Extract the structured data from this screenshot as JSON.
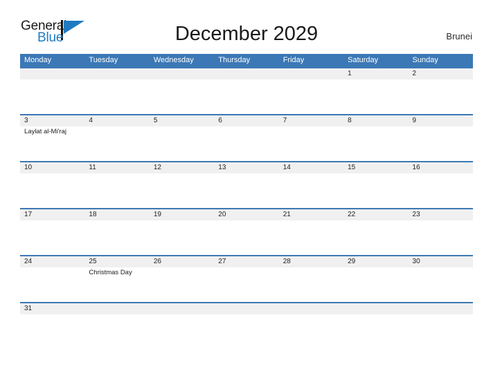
{
  "brand": {
    "word_one": "General",
    "word_two": "Blue",
    "flag_icon": "flag-triangle-icon",
    "accent_color": "#1f7ac2",
    "text_color": "#1a1a1a"
  },
  "header": {
    "title": "December 2029",
    "country": "Brunei"
  },
  "calendar": {
    "header_bg": "#3b78b5",
    "daynum_band_bg": "#f0f0f0",
    "row_border_color": "#3b78b5",
    "weekdays": [
      "Monday",
      "Tuesday",
      "Wednesday",
      "Thursday",
      "Friday",
      "Saturday",
      "Sunday"
    ],
    "weeks": [
      {
        "days": [
          {
            "num": "",
            "event": ""
          },
          {
            "num": "",
            "event": ""
          },
          {
            "num": "",
            "event": ""
          },
          {
            "num": "",
            "event": ""
          },
          {
            "num": "",
            "event": ""
          },
          {
            "num": "1",
            "event": ""
          },
          {
            "num": "2",
            "event": ""
          }
        ]
      },
      {
        "days": [
          {
            "num": "3",
            "event": "Laylat al-Mi'raj"
          },
          {
            "num": "4",
            "event": ""
          },
          {
            "num": "5",
            "event": ""
          },
          {
            "num": "6",
            "event": ""
          },
          {
            "num": "7",
            "event": ""
          },
          {
            "num": "8",
            "event": ""
          },
          {
            "num": "9",
            "event": ""
          }
        ]
      },
      {
        "days": [
          {
            "num": "10",
            "event": ""
          },
          {
            "num": "11",
            "event": ""
          },
          {
            "num": "12",
            "event": ""
          },
          {
            "num": "13",
            "event": ""
          },
          {
            "num": "14",
            "event": ""
          },
          {
            "num": "15",
            "event": ""
          },
          {
            "num": "16",
            "event": ""
          }
        ]
      },
      {
        "days": [
          {
            "num": "17",
            "event": ""
          },
          {
            "num": "18",
            "event": ""
          },
          {
            "num": "19",
            "event": ""
          },
          {
            "num": "20",
            "event": ""
          },
          {
            "num": "21",
            "event": ""
          },
          {
            "num": "22",
            "event": ""
          },
          {
            "num": "23",
            "event": ""
          }
        ]
      },
      {
        "days": [
          {
            "num": "24",
            "event": ""
          },
          {
            "num": "25",
            "event": "Christmas Day"
          },
          {
            "num": "26",
            "event": ""
          },
          {
            "num": "27",
            "event": ""
          },
          {
            "num": "28",
            "event": ""
          },
          {
            "num": "29",
            "event": ""
          },
          {
            "num": "30",
            "event": ""
          }
        ]
      },
      {
        "days": [
          {
            "num": "31",
            "event": ""
          },
          {
            "num": "",
            "event": ""
          },
          {
            "num": "",
            "event": ""
          },
          {
            "num": "",
            "event": ""
          },
          {
            "num": "",
            "event": ""
          },
          {
            "num": "",
            "event": ""
          },
          {
            "num": "",
            "event": ""
          }
        ]
      }
    ]
  }
}
